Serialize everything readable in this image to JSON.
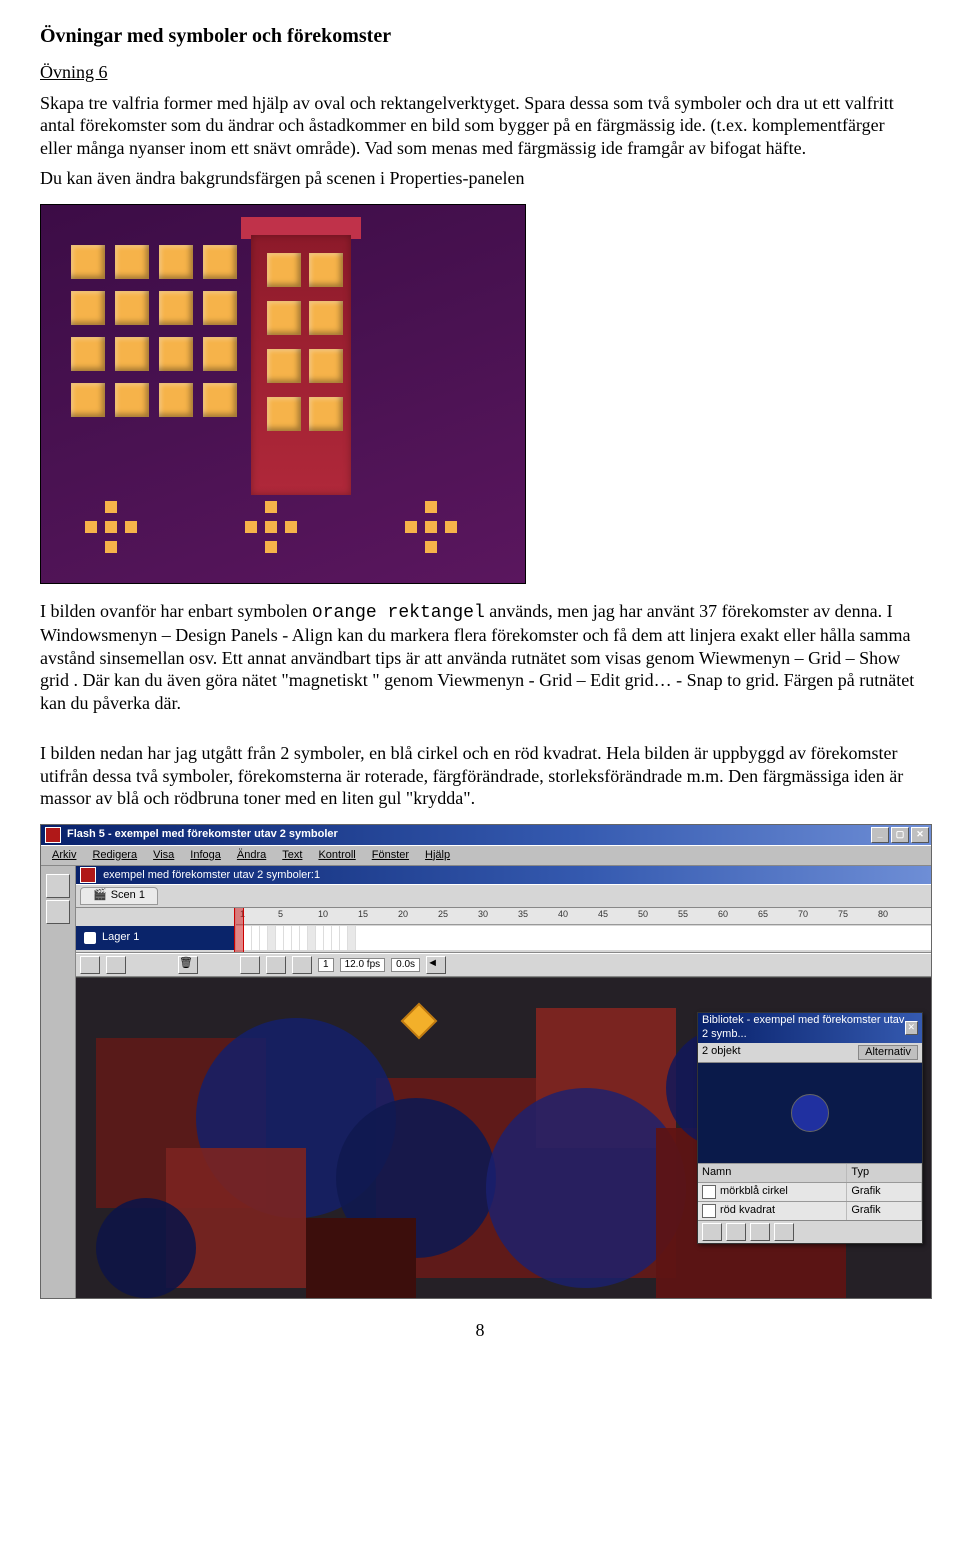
{
  "heading": "Övningar med symboler och förekomster",
  "ex6_label": "Övning 6",
  "para1": "Skapa tre valfria former med hjälp av oval och rektangelverktyget. Spara dessa som två symboler och dra ut ett valfritt antal förekomster som du ändrar och åstadkommer en bild som bygger på en färgmässig ide. (t.ex. komplementfärger eller många nyanser inom ett snävt område). Vad som menas med färgmässig ide framgår av bifogat häfte.",
  "para1b": "Du kan även ändra bakgrundsfärgen på scenen i Properties-panelen",
  "para2_a": "I bilden ovanför har enbart symbolen ",
  "para2_code": "orange rektangel",
  "para2_b": " används, men jag har använt 37 förekomster av denna. I Windowsmenyn – Design Panels - Align kan du markera flera förekomster och få dem att linjera exakt eller hålla samma avstånd sinsemellan osv. Ett annat användbart tips är att använda rutnätet som visas genom Wiewmenyn – Grid – Show grid . Där kan du även göra nätet \"magnetiskt \" genom Viewmenyn - Grid – Edit grid… - Snap to grid. Färgen på rutnätet kan du påverka där.",
  "para3": "I bilden nedan har jag utgått från 2 symboler, en blå cirkel och en röd kvadrat. Hela bilden är uppbyggd av förekomster utifrån dessa två symboler, förekomsterna är roterade, färgförändrade, storleksförändrade m.m. Den färgmässiga iden är massor av blå och rödbruna toner med en liten gul \"krydda\".",
  "page_number": "8",
  "flash": {
    "app_title": "Flash 5 - exempel med förekomster utav 2 symboler",
    "doc_title": "exempel med förekomster utav 2 symboler:1",
    "menus": [
      "Arkiv",
      "Redigera",
      "Visa",
      "Infoga",
      "Ändra",
      "Text",
      "Kontroll",
      "Fönster",
      "Hjälp"
    ],
    "scene": "Scen 1",
    "layer": "Lager 1",
    "fps": "12.0 fps",
    "time": "0.0s",
    "ruler_ticks": [
      "1",
      "5",
      "10",
      "15",
      "20",
      "25",
      "30",
      "35",
      "40",
      "45",
      "50",
      "55",
      "60",
      "65",
      "70",
      "75",
      "80"
    ],
    "status_left": [
      "⤺",
      "⤻"
    ],
    "win_min": "_",
    "win_max": "▢",
    "win_close": "✕",
    "library": {
      "title": "Bibliotek - exempel med förekomster utav 2 symb...",
      "count": "2 objekt",
      "alt": "Alternativ",
      "col_name": "Namn",
      "col_type": "Typ",
      "items": [
        {
          "name": "mörkblå cirkel",
          "type": "Grafik"
        },
        {
          "name": "röd kvadrat",
          "type": "Grafik"
        }
      ]
    }
  }
}
